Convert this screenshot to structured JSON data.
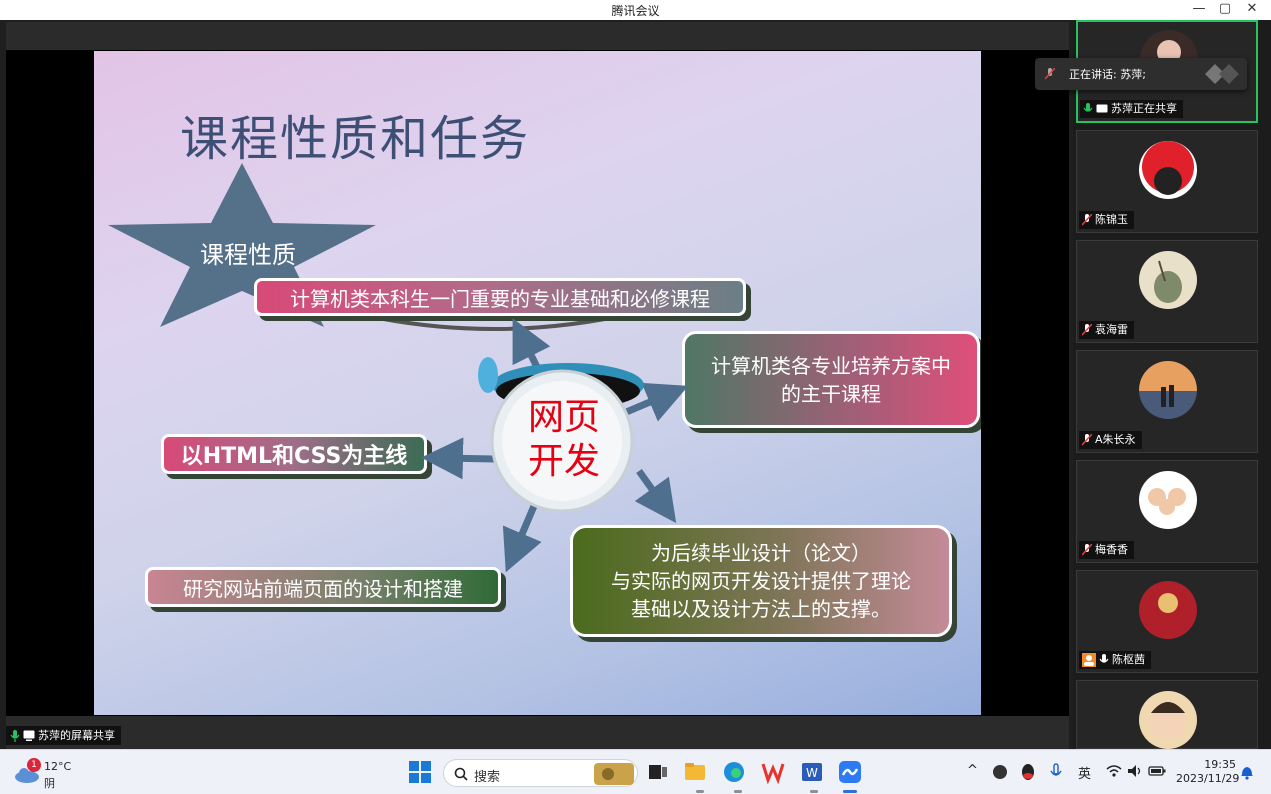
{
  "window": {
    "title": "腾讯会议",
    "controls": [
      "—",
      "▢",
      "✕"
    ]
  },
  "share": {
    "label": "苏萍的屏幕共享"
  },
  "slide": {
    "title": "课程性质和任务",
    "star_label": "课程性质",
    "center": [
      "网页",
      "开发"
    ],
    "boxes": {
      "top": "计算机类本科生一门重要的专业基础和必修课程",
      "right_line1": "计算机类各专业培养方案中",
      "right_line2": "的主干课程",
      "left": "以HTML和CSS为主线",
      "bottom_left": "研究网站前端页面的设计和搭建",
      "bottom_right_line1": "为后续毕业设计（论文）",
      "bottom_right_line2": "与实际的网页开发设计提供了理论",
      "bottom_right_line3": "基础以及设计方法上的支撑。"
    }
  },
  "speaker": {
    "label": "正在讲话:",
    "name": "苏萍;"
  },
  "participants": [
    {
      "name": "苏萍正在共享",
      "active": true,
      "mic": "on"
    },
    {
      "name": "陈锦玉",
      "mic": "off"
    },
    {
      "name": "袁海雷",
      "mic": "off"
    },
    {
      "name": "A朱长永",
      "mic": "off"
    },
    {
      "name": "梅香香",
      "mic": "off"
    },
    {
      "name": "陈枢茜",
      "mic": "on"
    }
  ],
  "taskbar": {
    "weather_temp": "12°C",
    "weather_cond": "阴",
    "weather_badge": "1",
    "search_placeholder": "搜索",
    "ime": "英",
    "time": "19:35",
    "date": "2023/11/29"
  },
  "colors": {
    "accent_green": "#27c45e",
    "slide_title": "#3d4f75",
    "hub_text": "#e60012"
  }
}
